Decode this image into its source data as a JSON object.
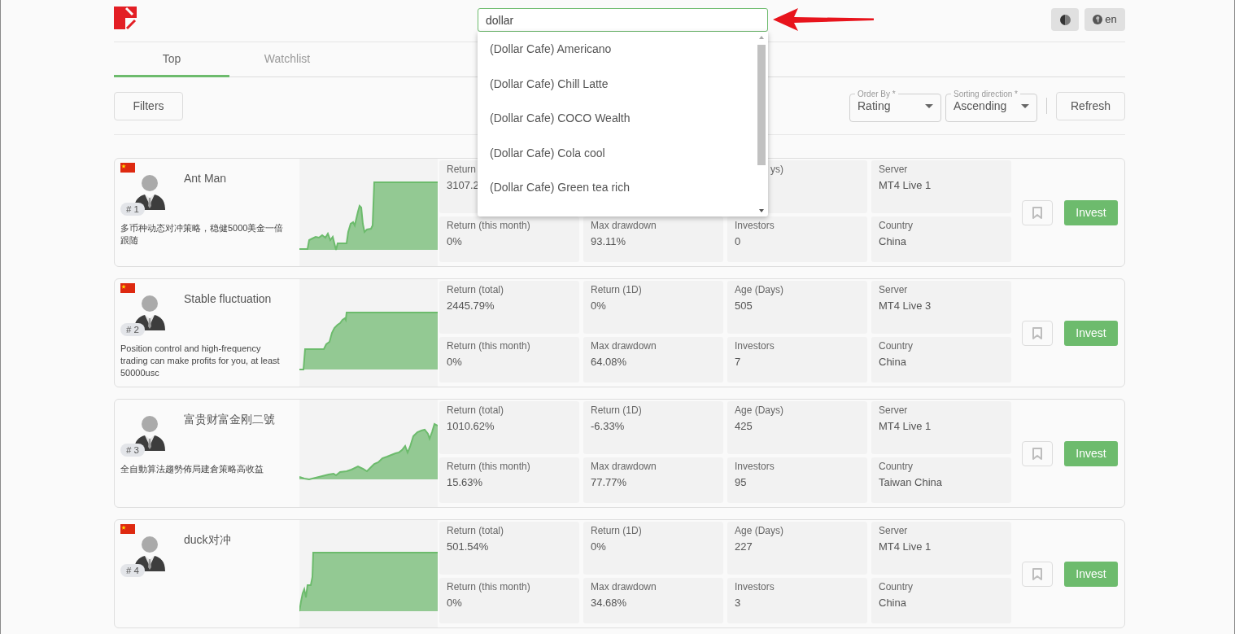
{
  "header": {
    "search": {
      "value": "dollar",
      "focused": true
    },
    "language": "en"
  },
  "suggestions": [
    "(Dollar Cafe) Americano",
    "(Dollar Cafe) Chill Latte",
    "(Dollar Cafe) COCO Wealth",
    "(Dollar Cafe) Cola cool",
    "(Dollar Cafe) Green tea rich"
  ],
  "annotation": {
    "kind": "arrow"
  },
  "tabs": [
    {
      "label": "Top",
      "selected": true
    },
    {
      "label": "Watchlist",
      "selected": false
    }
  ],
  "toolbar": {
    "filters": "Filters",
    "order_by": {
      "label": "Order By *",
      "value": "Rating"
    },
    "sorting_direction": {
      "label": "Sorting direction *",
      "value": "Ascending"
    },
    "refresh": "Refresh"
  },
  "strategies": [
    {
      "flag": true,
      "rank": "# 1",
      "name": "Ant Man",
      "description": "多币种动态对冲策略，稳健5000美金一倍跟随",
      "metrics": {
        "return_total": {
          "label": "Return",
          "value": "3107.2"
        },
        "age_days": {
          "label": "ys)",
          "clipped": true
        },
        "server": {
          "label": "Server",
          "value": "MT4 Live 1"
        },
        "return_this_month": {
          "label": "Return (this month)",
          "value": "0%"
        },
        "max_drawdown": {
          "label": "Max drawdown",
          "value": "93.11%"
        },
        "investors": {
          "label": "Investors",
          "value": "0"
        },
        "country": {
          "label": "Country",
          "value": "China"
        }
      },
      "bookmarked": false,
      "invest": "Invest"
    },
    {
      "flag": true,
      "rank": "# 2",
      "name": "Stable fluctuation",
      "description": "Position control and high-frequency trading can make profits for you, at least 50000usc",
      "metrics": {
        "return_total": {
          "label": "Return (total)",
          "value": "2445.79%"
        },
        "return_1d": {
          "label": "Return (1D)",
          "value": "0%"
        },
        "age_days": {
          "label": "Age (Days)",
          "value": "505"
        },
        "server": {
          "label": "Server",
          "value": "MT4 Live 3"
        },
        "return_this_month": {
          "label": "Return (this month)",
          "value": "0%"
        },
        "max_drawdown": {
          "label": "Max drawdown",
          "value": "64.08%"
        },
        "investors": {
          "label": "Investors",
          "value": "7"
        },
        "country": {
          "label": "Country",
          "value": "China"
        }
      },
      "bookmarked": false,
      "invest": "Invest"
    },
    {
      "flag": false,
      "rank": "# 3",
      "name": "富贵财富金刚二號",
      "description": "全自動算法趨勢佈局建倉策略高收益",
      "metrics": {
        "return_total": {
          "label": "Return (total)",
          "value": "1010.62%"
        },
        "return_1d": {
          "label": "Return (1D)",
          "value": "-6.33%"
        },
        "age_days": {
          "label": "Age (Days)",
          "value": "425"
        },
        "server": {
          "label": "Server",
          "value": "MT4 Live 1"
        },
        "return_this_month": {
          "label": "Return (this month)",
          "value": "15.63%"
        },
        "max_drawdown": {
          "label": "Max drawdown",
          "value": "77.77%"
        },
        "investors": {
          "label": "Investors",
          "value": "95"
        },
        "country": {
          "label": "Country",
          "value": "Taiwan China"
        }
      },
      "bookmarked": false,
      "invest": "Invest"
    },
    {
      "flag": true,
      "rank": "# 4",
      "name": "duck对冲",
      "metrics": {
        "return_total": {
          "label": "Return (total)",
          "value": "501.54%"
        },
        "return_1d": {
          "label": "Return (1D)",
          "value": "0%"
        },
        "age_days": {
          "label": "Age (Days)",
          "value": "227"
        },
        "server": {
          "label": "Server",
          "value": "MT4 Live 1"
        },
        "return_this_month": {
          "label": "Return (this month)",
          "value": "0%"
        },
        "max_drawdown": {
          "label": "Max drawdown",
          "value": "34.68%"
        },
        "investors": {
          "label": "Investors",
          "value": "3"
        },
        "country": {
          "label": "Country",
          "value": "China"
        }
      },
      "bookmarked": false,
      "invest": "Invest"
    }
  ]
}
